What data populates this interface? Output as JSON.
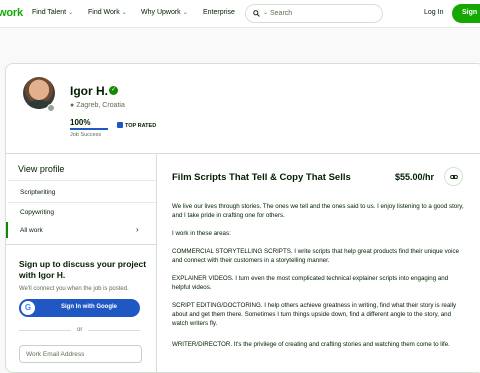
{
  "header": {
    "logo_text": "work",
    "nav": [
      "Find Talent",
      "Find Work",
      "Why Upwork",
      "Enterprise"
    ],
    "search_placeholder": "Search",
    "login_label": "Log In",
    "signup_label": "Sign"
  },
  "profile": {
    "name": "Igor H.",
    "location": "Zagreb, Croatia",
    "job_success": "100%",
    "job_success_fraction": 1.0,
    "job_success_label": "Job Success",
    "badge": "TOP RATED",
    "title": "Film Scripts That Tell & Copy That Sells",
    "rate": "$55.00/hr"
  },
  "sidebar": {
    "title": "View profile",
    "items": [
      {
        "label": "Scriptwriting"
      },
      {
        "label": "Copywriting"
      },
      {
        "label": "All work"
      }
    ]
  },
  "signup_panel": {
    "title": "Sign up to discuss your project with Igor H.",
    "subtitle": "We'll connect you when the job is posted.",
    "google_label": "Sign In with Google",
    "or": "or",
    "email_placeholder": "Work Email Address"
  },
  "description": [
    "We live our lives through stories. The ones we tell and the ones said to us. I enjoy listening to a good story, and I take pride in crafting one for others.",
    "I work in these areas:",
    "COMMERCIAL STORYTELLING SCRIPTS. I write scripts that help great products find their unique voice and connect with their customers in a storytelling manner.",
    "EXPLAINER VIDEOS. I turn even the most complicated technical explainer scripts into engaging and helpful videos.",
    "SCRIPT EDITING/DOCTORING. I help others achieve greatness in writing, find what their story is really about and get them there. Sometimes I turn things upside down, find a different angle to the story, and watch writers fly.",
    "WRITER/DIRECTOR. It's the privilege of creating and crafting stories and watching them come to life."
  ],
  "colors": {
    "brand_green": "#14a800",
    "verified_green": "#108a00",
    "google_blue": "#1f57c3"
  },
  "icons": {
    "search": "search-icon",
    "pin": "location-pin-icon",
    "verified": "verified-check-icon",
    "link": "link-icon",
    "google": "google-g-icon",
    "chevron": "chevron-right-icon"
  }
}
